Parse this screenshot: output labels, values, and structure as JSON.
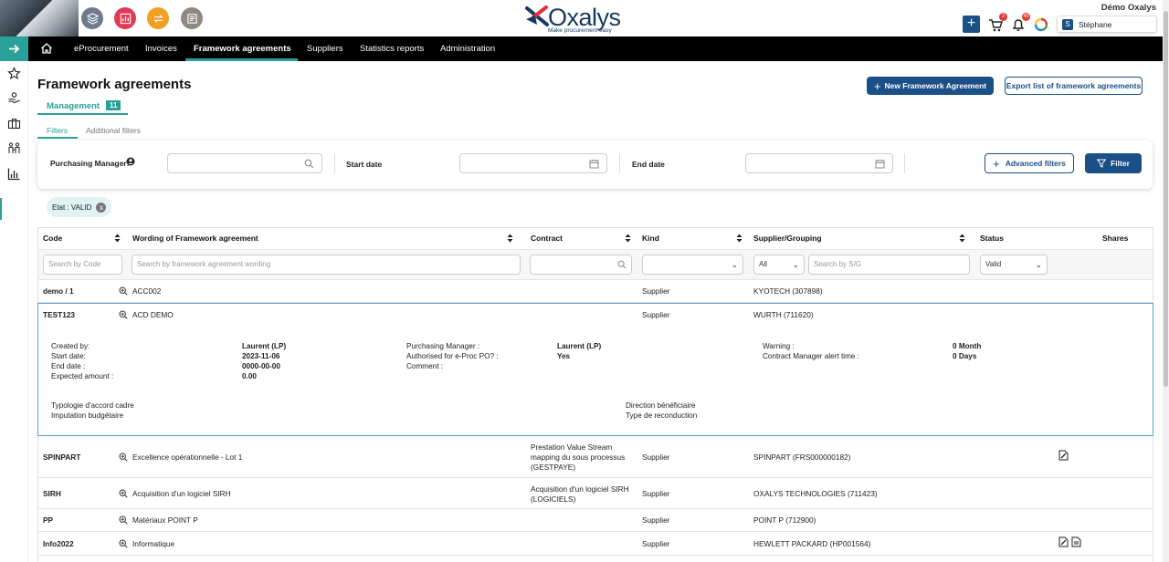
{
  "company": "Démo Oxalys",
  "logo": {
    "name": "Oxalys",
    "tagline": "Make procurement easy"
  },
  "header": {
    "cart_badge": "2",
    "bell_badge": "45",
    "user_initial": "S",
    "user_name": "Stéphane"
  },
  "nav": {
    "items": [
      "eProcurement",
      "Invoices",
      "Framework agreements",
      "Suppliers",
      "Statistics reports",
      "Administration"
    ]
  },
  "page": {
    "title": "Framework agreements",
    "tab_label": "Management",
    "tab_count": "11",
    "new_button": "New Framework Agreement",
    "export_button": "Export list of framework agreements",
    "subtab_filters": "Filters",
    "subtab_additional": "Additional filters"
  },
  "filters": {
    "purchasing_manager_label": "Purchasing Manager:",
    "start_date_label": "Start date",
    "end_date_label": "End date",
    "advanced_button": "Advanced filters",
    "filter_button": "Filter",
    "chip": "Etat : VALID",
    "chip_close": "x"
  },
  "table": {
    "headers": {
      "code": "Code",
      "wording": "Wording of Framework agreement",
      "contract": "Contract",
      "kind": "Kind",
      "supplier": "Supplier/Grouping",
      "status": "Status",
      "shares": "Shares"
    },
    "placeholders": {
      "code": "Search by Code",
      "wording": "Search by framework agreement wording",
      "supplier": "Search by S/G"
    },
    "selects": {
      "supplier_scope": "All",
      "status": "Valid"
    },
    "rows": [
      {
        "code": "demo / 1",
        "wording": "ACC002",
        "contract": "",
        "kind": "Supplier",
        "supplier": "KYOTECH (307898)"
      },
      {
        "code": "TEST123",
        "wording": "ACD DEMO",
        "contract": "",
        "kind": "Supplier",
        "supplier": "WURTH (711620)"
      },
      {
        "code": "SPINPART",
        "wording": "Excellence opérationnelle - Lot 1",
        "contract": "Prestation Value Stream mapping du sous processus (GESTPAYE)",
        "contract_lines": [
          "Prestation Value Stream",
          "mapping du sous processus",
          "(GESTPAYE)"
        ],
        "kind": "Supplier",
        "supplier": "SPINPART (FRS000000182)"
      },
      {
        "code": "SIRH",
        "wording": "Acquisition d'un logiciel SIRH",
        "contract": "Acquisition d'un logiciel SIRH (LOGICIELS)",
        "contract_lines": [
          "Acquisition d'un logiciel SIRH",
          "(LOGICIELS)"
        ],
        "kind": "Supplier",
        "supplier": "OXALYS TECHNOLOGIES (711423)"
      },
      {
        "code": "PP",
        "wording": "Matériaux POINT P",
        "contract": "",
        "kind": "Supplier",
        "supplier": "POINT P (712900)"
      },
      {
        "code": "Info2022",
        "wording": "Informatique",
        "contract": "",
        "kind": "Supplier",
        "supplier": "HEWLETT PACKARD (HP001564)"
      }
    ]
  },
  "detail": {
    "created_by_label": "Created by:",
    "created_by": "Laurent (LP)",
    "start_date_label": "Start date:",
    "start_date": "2023-11-06",
    "end_date_label": "End date :",
    "end_date": "0000-00-00",
    "expected_amount_label": "Expected amount :",
    "expected_amount": "0.00",
    "purchasing_manager_label": "Purchasing Manager :",
    "purchasing_manager": "Laurent (LP)",
    "authorised_label": "Authorised for e-Proc PO? :",
    "authorised": "Yes",
    "comment_label": "Comment :",
    "warning_label": "Warning :",
    "warning": "0 Month",
    "alert_label": "Contract Manager alert time :",
    "alert": "0 Days",
    "typologie": "Typologie d'accord cadre",
    "imputation": "Imputation budgétaire",
    "direction": "Direction bénéficiaire",
    "reconduction": "Type de reconduction"
  },
  "colors": {
    "navy": "#1b4f88",
    "teal": "#2aa198",
    "nav_bg": "#000000"
  },
  "icons": [
    "layers-icon",
    "chart-icon",
    "exchange-icon",
    "catalog-icon",
    "plus-icon",
    "cart-icon",
    "bell-icon",
    "ring-icon",
    "home-icon",
    "star-icon",
    "hand-icon",
    "briefcase-icon",
    "people-icon",
    "bar-chart-icon",
    "calendar-icon",
    "search-icon",
    "funnel-icon",
    "zoom-icon",
    "document-edit-icon"
  ]
}
